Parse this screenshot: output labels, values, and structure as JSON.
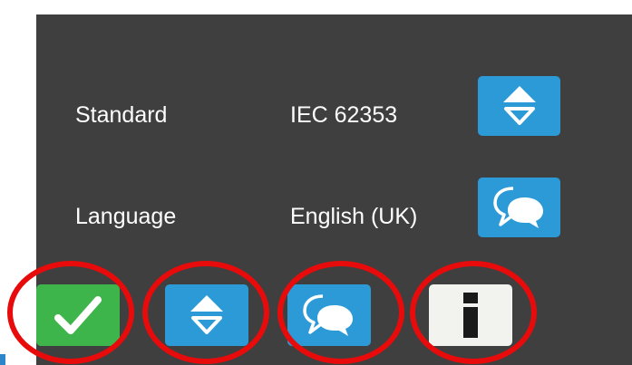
{
  "settings": {
    "standard": {
      "label": "Standard",
      "value": "IEC 62353",
      "button_icon": "up-down-arrows-icon"
    },
    "language": {
      "label": "Language",
      "value": "English (UK)",
      "button_icon": "speech-bubbles-icon"
    }
  },
  "toolbar": {
    "buttons": [
      {
        "icon": "checkmark-icon",
        "color": "#3db54a"
      },
      {
        "icon": "up-down-arrows-icon",
        "color": "#2d9ad8"
      },
      {
        "icon": "speech-bubbles-icon",
        "color": "#2d9ad8"
      },
      {
        "icon": "info-icon",
        "color": "#f2f2ef"
      }
    ]
  },
  "colors": {
    "screen_background": "#3f3f3f",
    "annotation_ring": "#e80b0b",
    "text": "#ffffff"
  }
}
